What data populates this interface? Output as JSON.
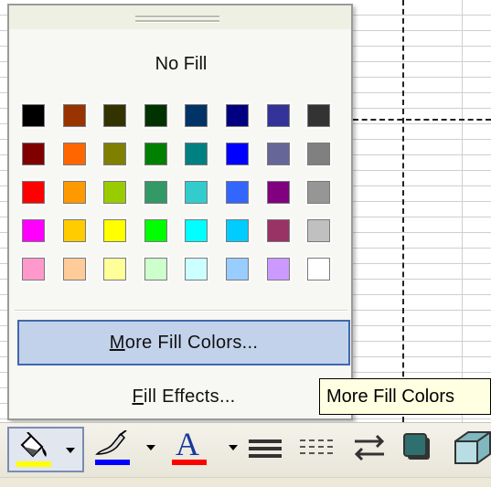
{
  "menu": {
    "no_fill_label": "No Fill",
    "more_fill_colors_label": "More Fill Colors...",
    "more_fill_colors_mnemonic": "M",
    "more_fill_colors_rest": "ore Fill Colors...",
    "fill_effects_label": "Fill Effects...",
    "fill_effects_mnemonic": "F",
    "fill_effects_rest": "ill Effects...",
    "swatches": [
      [
        "#000000",
        "#993300",
        "#333300",
        "#003300",
        "#003366",
        "#000080",
        "#333399",
        "#333333"
      ],
      [
        "#800000",
        "#FF6600",
        "#808000",
        "#008000",
        "#008080",
        "#0000FF",
        "#666699",
        "#808080"
      ],
      [
        "#FF0000",
        "#FF9900",
        "#99CC00",
        "#339966",
        "#33CCCC",
        "#3366FF",
        "#800080",
        "#969696"
      ],
      [
        "#FF00FF",
        "#FFCC00",
        "#FFFF00",
        "#00FF00",
        "#00FFFF",
        "#00CCFF",
        "#993366",
        "#C0C0C0"
      ],
      [
        "#FF99CC",
        "#FFCC99",
        "#FFFF99",
        "#CCFFCC",
        "#CCFFFF",
        "#99CCFF",
        "#CC99FF",
        "#FFFFFF"
      ]
    ]
  },
  "tooltip": {
    "text": "More Fill Colors"
  },
  "toolbar": {
    "fill_color_accent": "#FFFF00",
    "line_color_accent": "#0000FF",
    "font_color_accent": "#FF0000",
    "font_color_glyph": "A",
    "icons": [
      "fill-color-icon",
      "line-color-icon",
      "font-color-icon",
      "line-style-icon",
      "dash-style-icon",
      "arrow-style-icon",
      "shadow-style-icon",
      "3d-style-icon"
    ]
  }
}
